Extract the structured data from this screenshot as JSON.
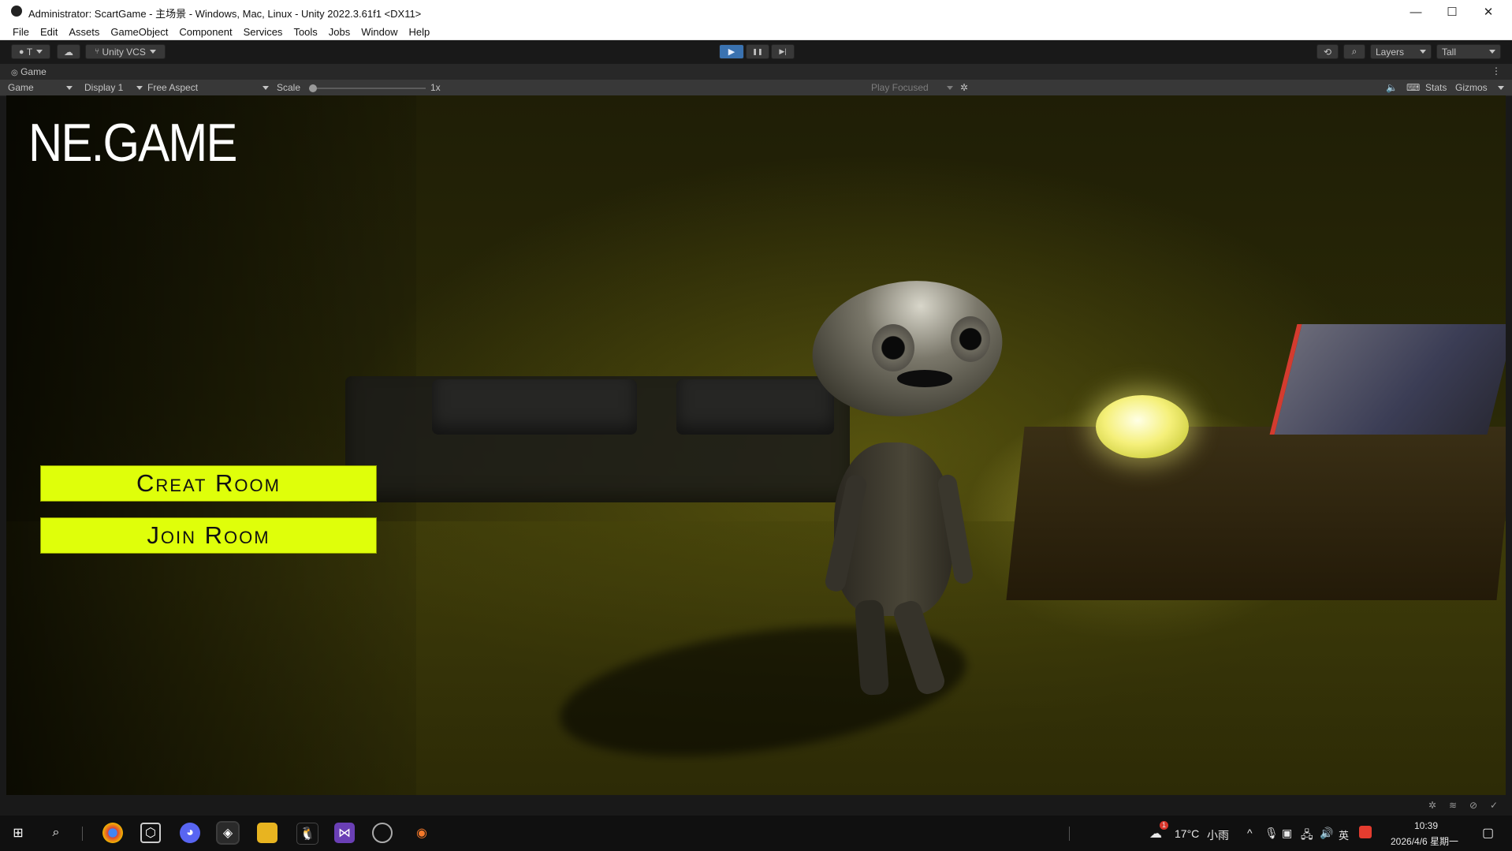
{
  "window": {
    "title": "Administrator: ScartGame - 主场景 - Windows, Mac, Linux - Unity 2022.3.61f1 <DX11>",
    "minimize_glyph": "—",
    "maximize_glyph": "☐",
    "close_glyph": "✕"
  },
  "menu": [
    "File",
    "Edit",
    "Assets",
    "GameObject",
    "Component",
    "Services",
    "Tools",
    "Jobs",
    "Window",
    "Help"
  ],
  "toolbar": {
    "account_label": "T",
    "vcs_label": "Unity VCS",
    "layers_label": "Layers",
    "layout_label": "Tall",
    "play_glyph": "▶",
    "pause_glyph": "❚❚",
    "step_glyph": "▶|"
  },
  "game_tab": {
    "tab_label": "Game",
    "view_select": "Game",
    "display_select": "Display 1",
    "aspect_select": "Free Aspect",
    "scale_label": "Scale",
    "scale_value": "1x",
    "scale_fraction": 0.0,
    "play_mode": "Play Focused",
    "stats_label": "Stats",
    "gizmos_label": "Gizmos"
  },
  "game_ui": {
    "logo": "NE.GAME",
    "create_room": "Creat Room",
    "join_room": "Join Room"
  },
  "taskbar": {
    "weather_temp": "17°C",
    "weather_desc": "小雨",
    "weather_badge": "1",
    "ime": "英",
    "time": "10:39",
    "date": "2026/4/6 星期一"
  }
}
